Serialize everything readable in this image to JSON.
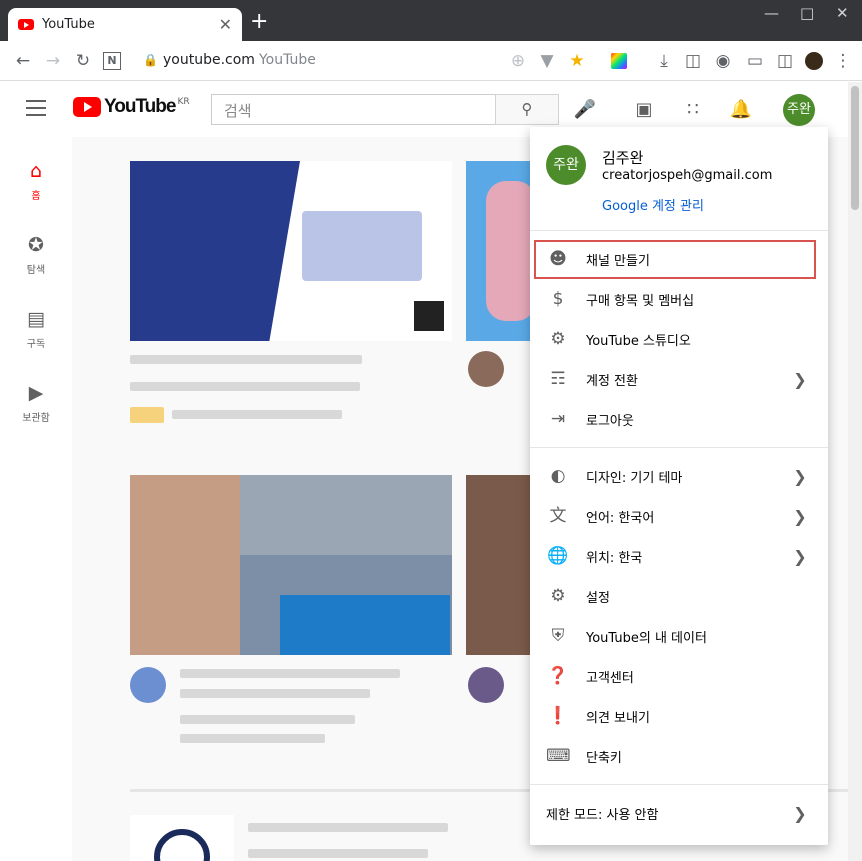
{
  "browser": {
    "tab_title": "YouTube",
    "tab_close": "✕",
    "new_tab": "+",
    "url": "youtube.com",
    "url_suffix": "YouTube"
  },
  "header": {
    "search_placeholder": "검색",
    "logo_text": "YouTube",
    "logo_region": "KR",
    "avatar_text": "주완"
  },
  "leftnav": {
    "items": [
      {
        "label": "홈",
        "icon": "home-icon"
      },
      {
        "label": "탐색",
        "icon": "compass-icon"
      },
      {
        "label": "구독",
        "icon": "subscriptions-icon"
      },
      {
        "label": "보관함",
        "icon": "library-icon"
      }
    ]
  },
  "account_menu": {
    "avatar_text": "주완",
    "name": "김주완",
    "email": "creatorjospeh@gmail.com",
    "manage_link": "Google 계정 관리",
    "items": [
      {
        "label": "채널 만들기",
        "icon": "person-icon",
        "has_chevron": false
      },
      {
        "label": "구매 항목 및 멤버십",
        "icon": "dollar-icon",
        "has_chevron": false
      },
      {
        "label": "YouTube 스튜디오",
        "icon": "gear-icon",
        "has_chevron": false
      },
      {
        "label": "계정 전환",
        "icon": "switch-account-icon",
        "has_chevron": true
      },
      {
        "label": "로그아웃",
        "icon": "logout-icon",
        "has_chevron": false
      },
      {
        "label": "디자인: 기기 테마",
        "icon": "theme-icon",
        "has_chevron": true
      },
      {
        "label": "언어: 한국어",
        "icon": "translate-icon",
        "has_chevron": true
      },
      {
        "label": "위치: 한국",
        "icon": "globe-icon",
        "has_chevron": true
      },
      {
        "label": "설정",
        "icon": "gear-icon",
        "has_chevron": false
      },
      {
        "label": "YouTube의 내 데이터",
        "icon": "shield-person-icon",
        "has_chevron": false
      },
      {
        "label": "고객센터",
        "icon": "help-icon",
        "has_chevron": false
      },
      {
        "label": "의견 보내기",
        "icon": "feedback-icon",
        "has_chevron": false
      },
      {
        "label": "단축키",
        "icon": "keyboard-icon",
        "has_chevron": false
      }
    ],
    "restricted_mode": "제한 모드: 사용 안함"
  },
  "colors": {
    "brand_red": "#ff0000",
    "link_blue": "#065fd4",
    "avatar_green": "#4c8c2b",
    "highlight_border": "#d9534f"
  }
}
